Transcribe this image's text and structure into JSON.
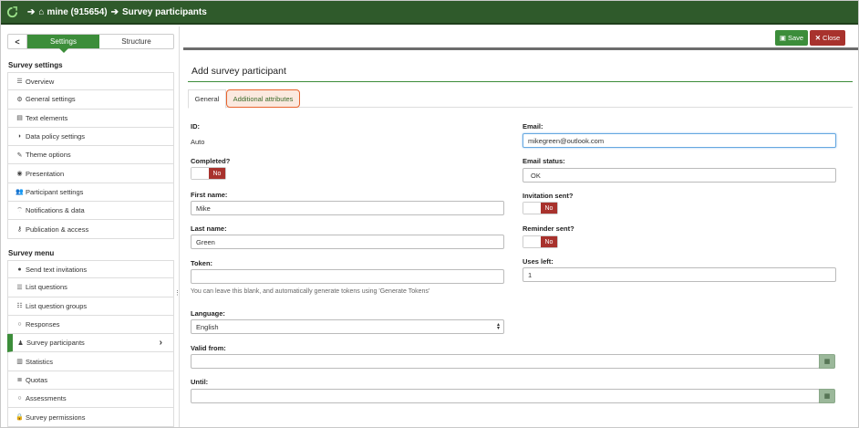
{
  "topbar": {
    "survey": "mine (915654)",
    "page": "Survey participants"
  },
  "sidebar": {
    "back_label": "<",
    "tabs": [
      {
        "label": "Settings"
      },
      {
        "label": "Structure"
      }
    ],
    "settings_title": "Survey settings",
    "settings_items": [
      {
        "label": "Overview"
      },
      {
        "label": "General settings"
      },
      {
        "label": "Text elements"
      },
      {
        "label": "Data policy settings"
      },
      {
        "label": "Theme options"
      },
      {
        "label": "Presentation"
      },
      {
        "label": "Participant settings"
      },
      {
        "label": "Notifications & data"
      },
      {
        "label": "Publication & access"
      }
    ],
    "menu_title": "Survey menu",
    "menu_items": [
      {
        "label": "Send text invitations"
      },
      {
        "label": "List questions"
      },
      {
        "label": "List question groups"
      },
      {
        "label": "Responses"
      },
      {
        "label": "Survey participants"
      },
      {
        "label": "Statistics"
      },
      {
        "label": "Quotas"
      },
      {
        "label": "Assessments"
      },
      {
        "label": "Survey permissions"
      }
    ]
  },
  "toolbar": {
    "save_label": "Save",
    "close_label": "Close"
  },
  "main": {
    "title": "Add survey participant",
    "tabs": [
      {
        "label": "General"
      },
      {
        "label": "Additional attributes"
      }
    ],
    "left": {
      "id_label": "ID:",
      "id_value": "Auto",
      "completed_label": "Completed?",
      "completed_value": "No",
      "firstname_label": "First name:",
      "firstname_value": "Mike",
      "lastname_label": "Last name:",
      "lastname_value": "Green",
      "token_label": "Token:",
      "token_value": "",
      "token_help": "You can leave this blank, and automatically generate tokens using 'Generate Tokens'",
      "language_label": "Language:",
      "language_value": "English",
      "validfrom_label": "Valid from:",
      "validfrom_value": "",
      "until_label": "Until:",
      "until_value": ""
    },
    "right": {
      "email_label": "Email:",
      "email_value": "mikegreen@outlook.com",
      "emailstatus_label": "Email status:",
      "emailstatus_value": "OK",
      "invitation_label": "Invitation sent?",
      "invitation_value": "No",
      "reminder_label": "Reminder sent?",
      "reminder_value": "No",
      "usesleft_label": "Uses left:",
      "usesleft_value": "1"
    }
  },
  "colors": {
    "brand_green": "#3c8d3a",
    "topbar": "#2f5a2b",
    "danger": "#a8322d",
    "highlight": "#e8642e"
  }
}
